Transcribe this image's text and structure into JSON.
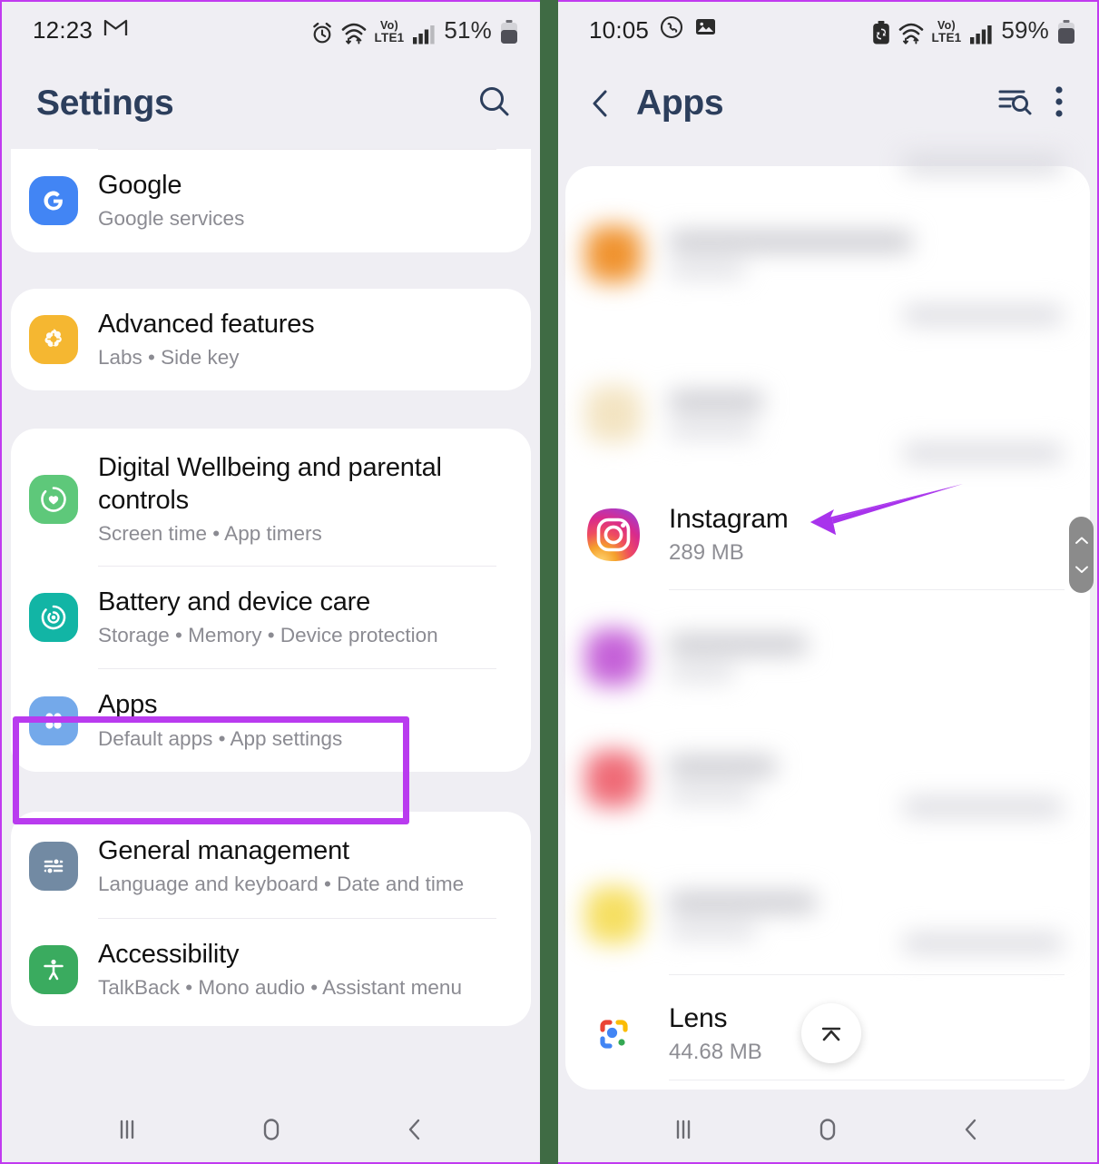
{
  "left_phone": {
    "status_bar": {
      "time": "12:23",
      "battery_percent": "51%",
      "network_label": "LTE1",
      "volte_label": "Vo)",
      "icons": [
        "gmail-icon",
        "alarm-icon",
        "wifi-icon",
        "volte-icon",
        "signal-icon",
        "battery-icon"
      ]
    },
    "title": "Settings",
    "search_icon": "search-icon",
    "cards": [
      {
        "rows": [
          {
            "icon": "google-icon",
            "title": "Google",
            "subtitle": "Google services"
          }
        ]
      },
      {
        "rows": [
          {
            "icon": "advanced-features-icon",
            "title": "Advanced features",
            "subtitle": "Labs  •  Side key"
          }
        ]
      },
      {
        "rows": [
          {
            "icon": "digital-wellbeing-icon",
            "title": "Digital Wellbeing and parental controls",
            "subtitle": "Screen time  •  App timers"
          },
          {
            "icon": "battery-care-icon",
            "title": "Battery and device care",
            "subtitle": "Storage  •  Memory  •  Device protection"
          },
          {
            "icon": "apps-icon",
            "title": "Apps",
            "subtitle": "Default apps  •  App settings",
            "highlighted": true
          }
        ]
      },
      {
        "rows": [
          {
            "icon": "general-management-icon",
            "title": "General management",
            "subtitle": "Language and keyboard  •  Date and time"
          },
          {
            "icon": "accessibility-icon",
            "title": "Accessibility",
            "subtitle": "TalkBack  •  Mono audio  •  Assistant menu"
          }
        ]
      }
    ],
    "nav_bar": {
      "recents": "recents-icon",
      "home": "home-icon",
      "back": "back-icon"
    }
  },
  "right_phone": {
    "status_bar": {
      "time": "10:05",
      "battery_percent": "59%",
      "network_label": "LTE1",
      "volte_label": "Vo)",
      "icons": [
        "whatsapp-icon",
        "gallery-icon",
        "battery-saver-icon",
        "wifi-icon",
        "volte-icon",
        "signal-icon",
        "battery-icon"
      ]
    },
    "back_icon": "back-chevron-icon",
    "title": "Apps",
    "actions": [
      "sort-search-icon",
      "more-options-icon"
    ],
    "apps": [
      {
        "name": "",
        "size": "",
        "blurred": true
      },
      {
        "name": "",
        "size": "",
        "blurred": true
      },
      {
        "name": "Instagram",
        "size": "289 MB",
        "blurred": false,
        "icon": "instagram-icon"
      },
      {
        "name": "",
        "size": "",
        "blurred": true
      },
      {
        "name": "",
        "size": "",
        "blurred": true
      },
      {
        "name": "",
        "size": "",
        "blurred": true
      },
      {
        "name": "Lens",
        "size": "44.68 MB",
        "blurred": false,
        "icon": "google-lens-icon"
      }
    ],
    "scroll_handle": "scroll-thumb",
    "scroll_to_top_button": "scroll-to-top-icon",
    "nav_bar": {
      "recents": "recents-icon",
      "home": "home-icon",
      "back": "back-icon"
    }
  },
  "annotations": {
    "highlight_color": "#b93bef",
    "arrow_color": "#a833ec",
    "arrow_target": "Instagram",
    "divider_color": "#3f6b44"
  }
}
